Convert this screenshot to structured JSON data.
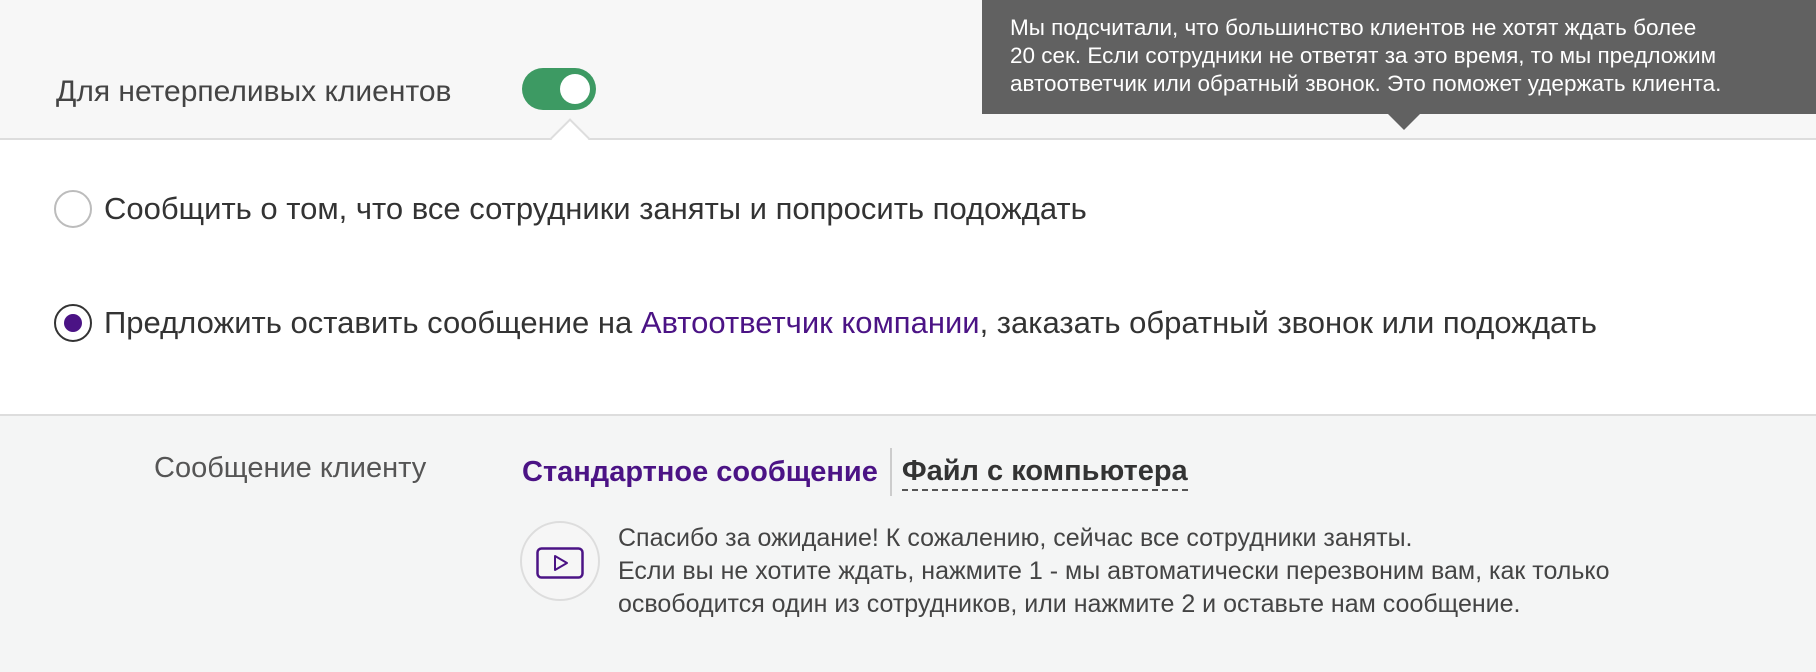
{
  "header": {
    "toggle_label": "Для нетерпеливых клиентов",
    "toggle_on": true
  },
  "tooltip": {
    "lines": [
      "Мы подсчитали, что большинство клиентов не хотят ждать более",
      "20 сек. Если сотрудники не ответят за это время, то мы предложим",
      "автоответчик или обратный звонок. Это поможет удержать клиента."
    ]
  },
  "options": [
    {
      "text": "Сообщить о том, что все сотрудники заняты и попросить подождать",
      "checked": false
    },
    {
      "text_before": "Предложить оставить сообщение на ",
      "link": "Автоответчик компании",
      "text_after": ", заказать обратный звонок или подождать",
      "checked": true
    }
  ],
  "message": {
    "label": "Сообщение клиенту",
    "tabs": [
      {
        "label": "Стандартное сообщение",
        "active": true
      },
      {
        "label": "Файл с компьютера",
        "active": false
      }
    ],
    "lines": [
      "Спасибо за ожидание! К сожалению, сейчас все сотрудники заняты.",
      "Если вы не хотите ждать, нажмите 1 - мы автоматически перезвоним вам, как только",
      "освободится один из сотрудников, или нажмите 2 и оставьте нам сообщение."
    ]
  },
  "colors": {
    "accent": "#4b1385",
    "toggle_on": "#3d9a63",
    "tooltip_bg": "#616161"
  },
  "icons": {
    "play": "play-icon"
  }
}
